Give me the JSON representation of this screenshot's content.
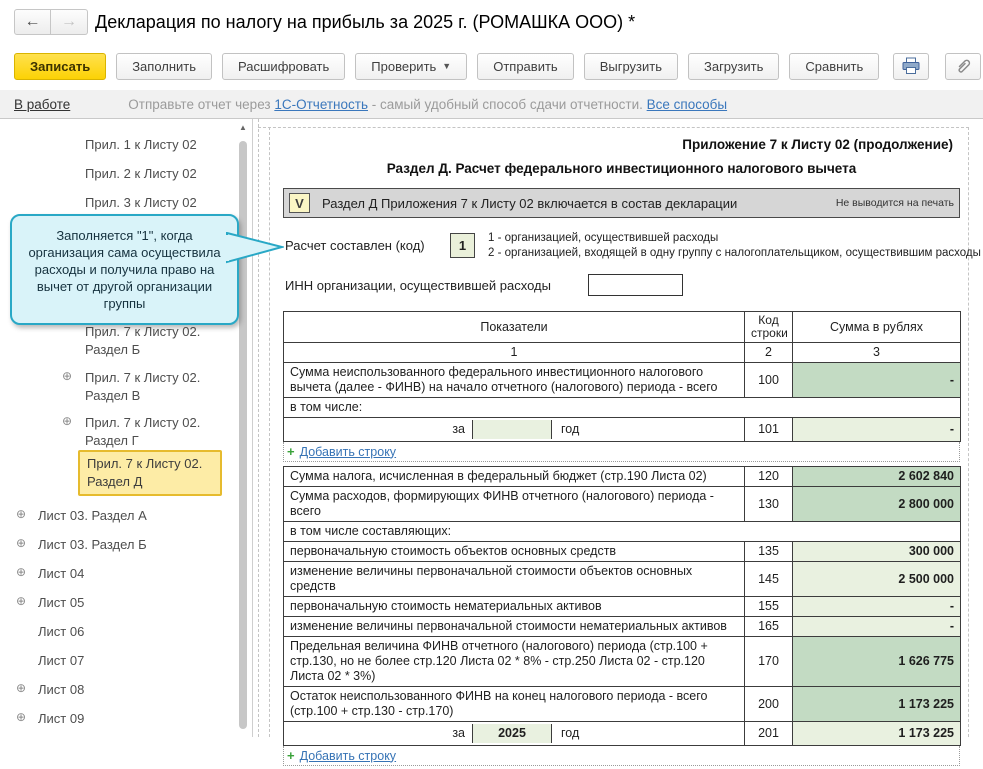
{
  "icons": {
    "back": "←",
    "forward": "→",
    "dropdown": "▼",
    "expand": "⊕",
    "scroll_up": "▲",
    "plus": "+",
    "checkbox": "V"
  },
  "window": {
    "title": "Декларация по налогу на прибыль за 2025 г. (РОМАШКА ООО) *"
  },
  "toolbar": {
    "save": "Записать",
    "fill": "Заполнить",
    "decipher": "Расшифровать",
    "check": "Проверить",
    "send": "Отправить",
    "export": "Выгрузить",
    "import": "Загрузить",
    "compare": "Сравнить"
  },
  "statusbar": {
    "status": "В работе",
    "prefix": "Отправьте отчет через ",
    "service_link": "1С-Отчетность",
    "middle": " - самый удобный способ сдачи отчетности. ",
    "all_methods_link": "Все способы"
  },
  "sidebar": {
    "items": [
      {
        "label": "Прил. 1 к Листу 02"
      },
      {
        "label": "Прил. 2 к Листу 02"
      },
      {
        "label": "Прил. 3 к Листу 02"
      },
      {
        "label": "Прил. 7 к Листу 02. Раздел Б"
      },
      {
        "label": "Прил. 7 к Листу 02. Раздел В"
      },
      {
        "label": "Прил. 7 к Листу 02. Раздел Г"
      },
      {
        "label": "Прил. 7 к Листу 02. Раздел Д"
      },
      {
        "label": "Лист 03. Раздел А"
      },
      {
        "label": "Лист 03. Раздел Б"
      },
      {
        "label": "Лист 04"
      },
      {
        "label": "Лист 05"
      },
      {
        "label": "Лист 06"
      },
      {
        "label": "Лист 07"
      },
      {
        "label": "Лист 08"
      },
      {
        "label": "Лист 09"
      }
    ]
  },
  "tooltip": {
    "text": "Заполняется \"1\", когда организация сама осуществила расходы и получила право на вычет от другой организации группы"
  },
  "main": {
    "page_header": "Приложение 7 к Листу 02 (продолжение)",
    "section_title": "Раздел Д. Расчет федерального инвестиционного налогового вычета",
    "include": {
      "label": "Раздел Д Приложения 7 к Листу 02 включается в состав декларации",
      "note": "Не выводится на печать"
    },
    "calc": {
      "label": "Расчет составлен (код)",
      "value": "1",
      "hint1": "1 - организацией, осуществившей расходы",
      "hint2": "2 - организацией, входящей в одну группу с налогоплательщиком, осуществившим расходы"
    },
    "inn": {
      "label": "ИНН организации, осуществившей расходы",
      "value": ""
    },
    "table": {
      "headers": [
        "Показатели",
        "Код строки",
        "Сумма в рублях"
      ],
      "col_numbers": [
        "1",
        "2",
        "3"
      ],
      "add_row_label": "Добавить строку",
      "r100": {
        "label": "Сумма неиспользованного федерального инвестиционного налогового вычета (далее - ФИНВ) на начало отчетного (налогового) периода - всего",
        "code": "100",
        "value": "-"
      },
      "group1": "в том числе:",
      "r101": {
        "za": "за",
        "year": "",
        "god": "год",
        "code": "101",
        "value": "-"
      },
      "r120": {
        "label": "Сумма налога, исчисленная в федеральный бюджет (стр.190 Листа 02)",
        "code": "120",
        "value": "2 602 840"
      },
      "r130": {
        "label": "Сумма расходов, формирующих ФИНВ отчетного (налогового) периода - всего",
        "code": "130",
        "value": "2 800 000"
      },
      "group2": "в том числе составляющих:",
      "r135": {
        "label": "первоначальную стоимость объектов основных средств",
        "code": "135",
        "value": "300 000"
      },
      "r145": {
        "label": "изменение величины первоначальной стоимости объектов основных средств",
        "code": "145",
        "value": "2 500 000"
      },
      "r155": {
        "label": "первоначальную стоимость нематериальных активов",
        "code": "155",
        "value": "-"
      },
      "r165": {
        "label": "изменение величины первоначальной стоимости нематериальных активов",
        "code": "165",
        "value": "-"
      },
      "r170": {
        "label": "Предельная величина ФИНВ отчетного (налогового) периода (стр.100 + стр.130, но не более стр.120 Листа 02 * 8% - стр.250 Листа 02 - стр.120 Листа 02 * 3%)",
        "code": "170",
        "value": "1 626 775"
      },
      "r200": {
        "label": "Остаток неиспользованного ФИНВ на конец налогового периода - всего (стр.100 + стр.130 - стр.170)",
        "code": "200",
        "value": "1 173 225"
      },
      "r201": {
        "za": "за",
        "year": "2025",
        "god": "год",
        "code": "201",
        "value": "1 173 225"
      }
    }
  }
}
